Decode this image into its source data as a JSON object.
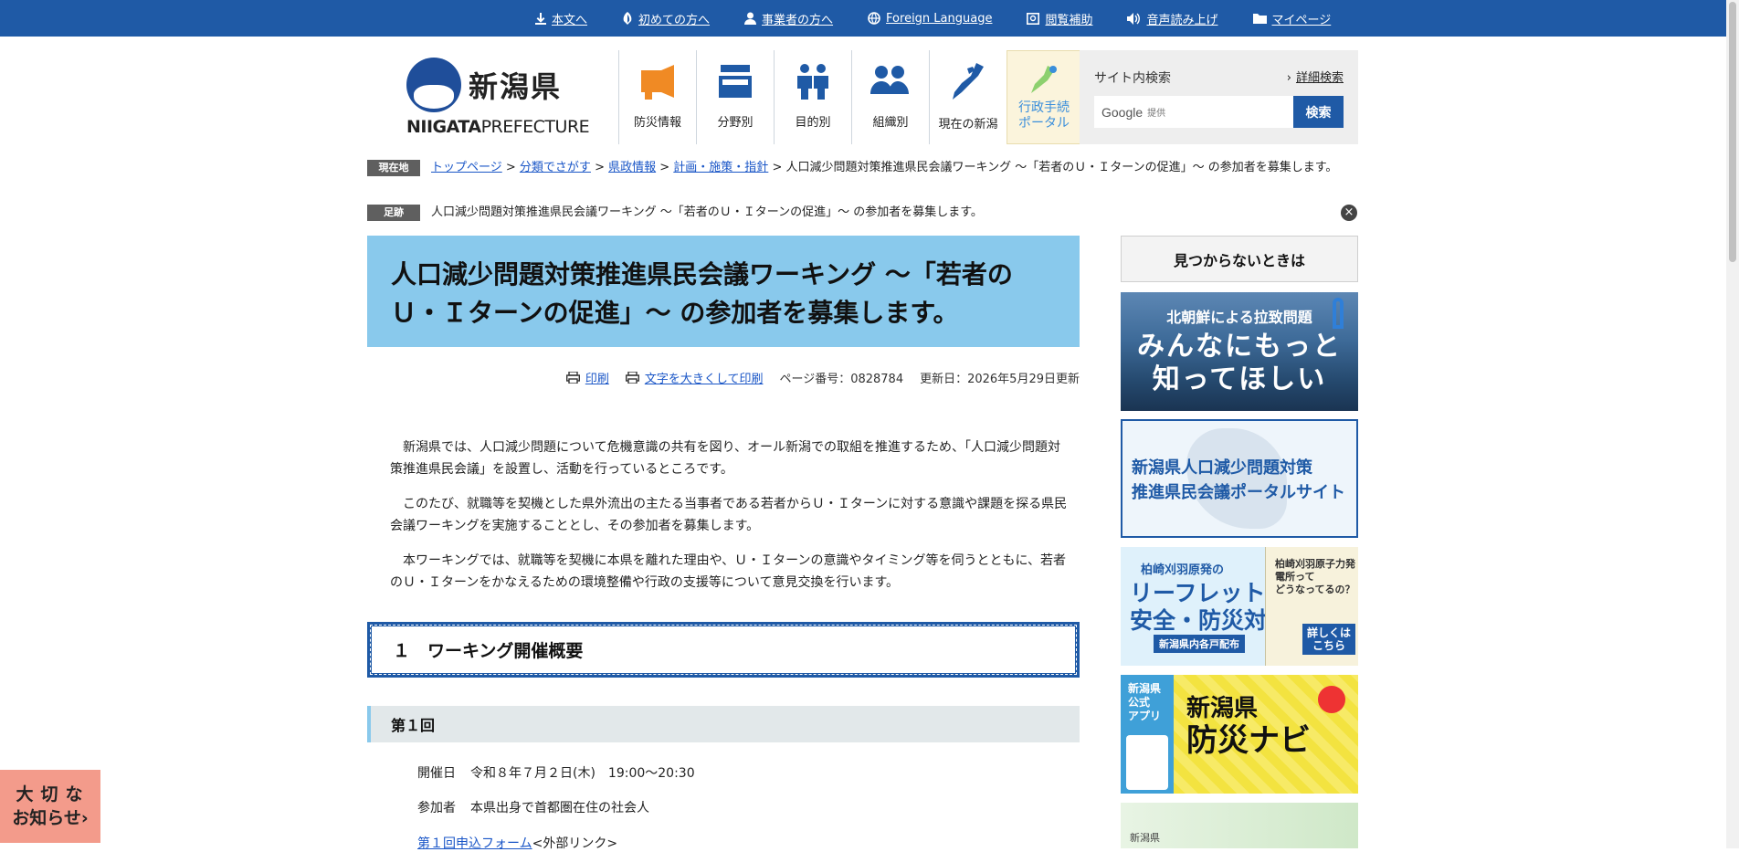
{
  "utility_nav": [
    {
      "label": "本文へ",
      "icon": "download-icon"
    },
    {
      "label": "初めての方へ",
      "icon": "leaf-icon"
    },
    {
      "label": "事業者の方へ",
      "icon": "person-icon"
    },
    {
      "label": "Foreign Language",
      "icon": "globe-icon"
    },
    {
      "label": "閲覧補助",
      "icon": "magnify-icon"
    },
    {
      "label": "音声読み上げ",
      "icon": "speaker-icon"
    },
    {
      "label": "マイページ",
      "icon": "folder-icon"
    }
  ],
  "logo": {
    "jp": "新潟県",
    "en_bold": "NIIGATA",
    "en_light": "PREFECTURE"
  },
  "global_nav": [
    {
      "label": "防災情報",
      "icon": "megaphone-icon",
      "color": "#f08a24"
    },
    {
      "label": "分野別",
      "icon": "tray-icon",
      "color": "#1f5aa6"
    },
    {
      "label": "目的別",
      "icon": "people-icon",
      "color": "#1f5aa6"
    },
    {
      "label": "組織別",
      "icon": "group-icon",
      "color": "#1f5aa6"
    },
    {
      "label": "現在の新潟",
      "icon": "map-icon",
      "color": "#1f5aa6"
    },
    {
      "label": "行政手続\nポータル",
      "icon": "portal-icon",
      "color": "#3a8edb"
    }
  ],
  "search": {
    "title": "サイト内検索",
    "advanced": "詳細検索",
    "brand": "Google",
    "provided": "提供",
    "button": "検索"
  },
  "breadcrumb": {
    "tag": "現在地",
    "links": [
      "トップページ",
      "分類でさがす",
      "県政情報",
      "計画・施策・指針"
    ],
    "current": "人口減少問題対策推進県民会議ワーキング ～「若者のＵ・Ｉターンの促進」～ の参加者を募集します。"
  },
  "history": {
    "tag": "足跡",
    "text": "人口減少問題対策推進県民会議ワーキング ～「若者のＵ・Ｉターンの促進」～ の参加者を募集します。",
    "close": "×"
  },
  "page_title": "人口減少問題対策推進県民会議ワーキング ～「若者のＵ・Ｉターンの促進」～ の参加者を募集します。",
  "tools": {
    "print": "印刷",
    "print_large": "文字を大きくして印刷",
    "page_no": "ページ番号：0828784",
    "updated": "更新日：2026年5月29日更新"
  },
  "body": [
    "新潟県では、人口減少問題について危機意識の共有を図り、オール新潟での取組を推進するため、「人口減少問題対策推進県民会議」を設置し、活動を行っているところです。",
    "このたび、就職等を契機とした県外流出の主たる当事者である若者からＵ・Ｉターンに対する意識や課題を探る県民会議ワーキングを実施することとし、その参加者を募集します。",
    "本ワーキングでは、就職等を契機に本県を離れた理由や、Ｕ・Ｉターンの意識やタイミング等を伺うとともに、若者のＵ・Ｉターンをかなえるための環境整備や行政の支援等について意見交換を行います。"
  ],
  "section1": "１　ワーキング開催概要",
  "round1": {
    "heading": "第１回",
    "date_label": "開催日",
    "date": "令和８年７月２日(木)　19:00～20:30",
    "who_label": "参加者",
    "who": "本県出身で首都圏在住の社会人",
    "form_link": "第１回申込フォーム",
    "form_suffix": "<外部リンク>"
  },
  "sidebar": {
    "help": "見つからないときは",
    "banner1": {
      "l1": "北朝鮮による拉致問題",
      "l2": "みんなにもっと\n知ってほしい"
    },
    "banner2": "新潟県人口減少問題対策\n推進県民会議ポータルサイト",
    "banner3": {
      "t1": "柏崎刈羽原発の",
      "t2": "リーフレット\n安全・防災対策",
      "t3": "新潟県内各戸配布",
      "doc": "柏崎刈羽原子力発電所って\nどうなってるの？",
      "more": "詳しくは\nこちら"
    },
    "banner4": {
      "a": "新潟県\n公式\nアプリ",
      "t_small": "新潟県",
      "t": "防災ナビ"
    },
    "banner5": "新潟県"
  },
  "notice": {
    "line1": "大切な",
    "line2": "お知らせ›"
  }
}
